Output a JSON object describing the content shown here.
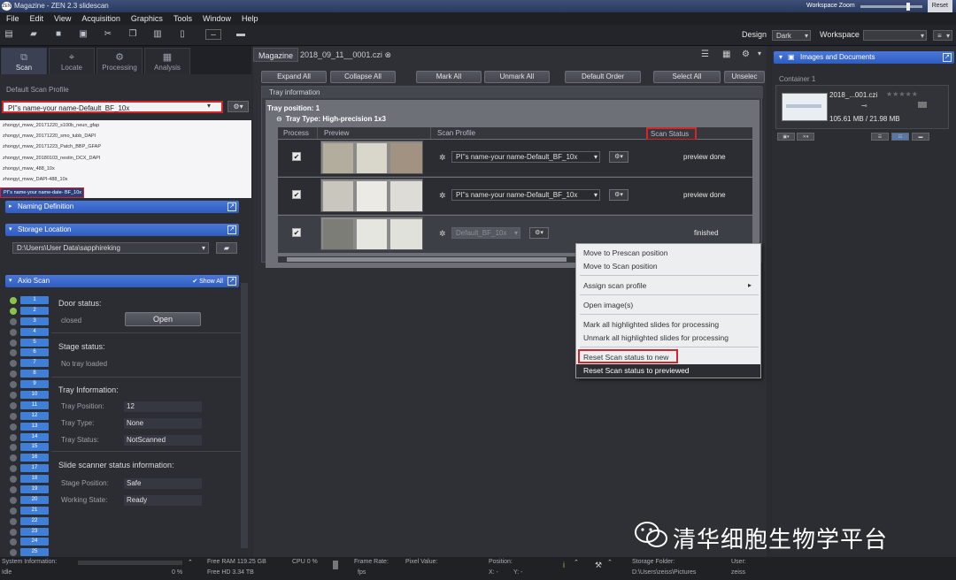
{
  "window": {
    "title": "Magazine - ZEN 2.3 slidescan",
    "logo": "ZEN",
    "workspace_zoom": "Workspace Zoom",
    "reset": "Reset"
  },
  "menu": [
    "File",
    "Edit",
    "View",
    "Acquisition",
    "Graphics",
    "Tools",
    "Window",
    "Help"
  ],
  "toolbar": {
    "design_label": "Design",
    "design_value": "Dark",
    "workspace_label": "Workspace",
    "workspace_value": ""
  },
  "left_tabs": [
    {
      "label": "Scan",
      "icon": "scan-icon"
    },
    {
      "label": "Locate",
      "icon": "locate-icon"
    },
    {
      "label": "Processing",
      "icon": "processing-icon"
    },
    {
      "label": "Analysis",
      "icon": "analysis-icon"
    }
  ],
  "scan_profile": {
    "label": "Default Scan Profile",
    "value": "PI''s name-your name-Default_BF_10x",
    "list": [
      "zhongyi_mww_20171220_s100b_neun_gfap",
      "zhongyi_mww_20171220_smo_tubb_DAPI",
      "zhongyi_mww_20171223_Patch_BBP_GFAP",
      "zhongyi_mww_20180103_nestin_DCX_DAPI",
      "zhongyi_mww_488_10x",
      "zhongyi_mww_DAPI-488_10x"
    ],
    "selected": "PI''s name-your name-date- BF_10x"
  },
  "naming": {
    "title": "Naming Definition"
  },
  "storage": {
    "title": "Storage Location",
    "path": "D:\\Users\\User Data\\sapphireking"
  },
  "axio": {
    "title": "Axio Scan",
    "show_all": "Show All",
    "door_status": "Door status:",
    "door_value": "closed",
    "open_button": "Open",
    "stage_status": "Stage status:",
    "stage_value": "No tray loaded",
    "tray_info": "Tray Information:",
    "tray_position_label": "Tray Position:",
    "tray_position": "12",
    "tray_type_label": "Tray Type:",
    "tray_type": "None",
    "tray_status_label": "Tray Status:",
    "tray_status": "NotScanned",
    "scanner_info": "Slide scanner status information:",
    "stage_pos_label": "Stage Position:",
    "stage_pos": "Safe",
    "work_state_label": "Working State:",
    "work_state": "Ready",
    "slots": [
      "1",
      "2",
      "3",
      "4",
      "5",
      "6",
      "7",
      "8",
      "9",
      "10",
      "11",
      "12",
      "13",
      "14",
      "15",
      "16",
      "17",
      "18",
      "19",
      "20",
      "21",
      "22",
      "23",
      "24",
      "25"
    ]
  },
  "center": {
    "tabs": [
      "Magazine",
      "2018_09_11__0001.czi"
    ],
    "buttons": [
      "Expand All",
      "Collapse All",
      "Mark All",
      "Unmark All",
      "Default Order",
      "Select All",
      "Unselec"
    ],
    "tray_information": "Tray information",
    "tray_position": "Tray position:  1",
    "tray_type": "Tray Type:  High-precision 1x3",
    "columns": [
      "Process",
      "Preview",
      "Scan Profile",
      "Scan Status"
    ],
    "rows": [
      {
        "profile": "PI''s name-your name-Default_BF_10x",
        "status": "preview done"
      },
      {
        "profile": "PI''s name-your name-Default_BF_10x",
        "status": "preview done"
      },
      {
        "profile": "Default_BF_10x",
        "status": "finished"
      }
    ]
  },
  "context_menu": [
    "Move to Prescan position",
    "Move to Scan position",
    "Assign scan profile",
    "Open image(s)",
    "Mark all highlighted slides for processing",
    "Unmark all highlighted slides for processing",
    "Reset Scan status to new",
    "Reset Scan status to previewed"
  ],
  "right": {
    "title": "Images and Documents",
    "container": "Container 1",
    "doc_name": "2018_...001.czi",
    "doc_stars": "★★★★★",
    "doc_size": "105.61 MB / 21.98 MB"
  },
  "status": {
    "sys_info": "System Information:",
    "idle": "Idle",
    "progress": "0 %",
    "free_ram": "Free RAM  119.25 GB",
    "free_hd": "Free HD    3.34 TB",
    "cpu": "CPU  0 %",
    "frame_rate": "Frame Rate:",
    "fps": "fps",
    "pixel_value": "Pixel Value:",
    "position": "Position:",
    "x": "X: -",
    "y": "Y: -",
    "storage_folder": "Storage Folder:",
    "storage_path": "D:\\Users\\zeiss\\Pictures",
    "user": "User:",
    "user_val": "zeiss"
  },
  "watermark": "清华细胞生物学平台"
}
